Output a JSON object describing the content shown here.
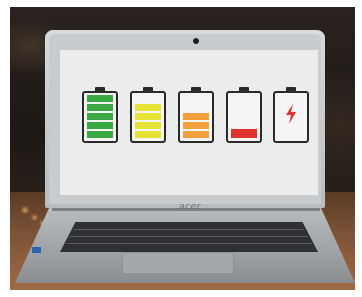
{
  "brand": {
    "logo_text": "acer"
  },
  "screen": {
    "batteries": [
      {
        "label": "full",
        "level": 1.0,
        "segments": 5,
        "color": "#3aa845"
      },
      {
        "label": "high",
        "level": 0.8,
        "segments": 4,
        "color": "#e6e234"
      },
      {
        "label": "medium",
        "level": 0.5,
        "segments": 3,
        "color": "#f2a03d"
      },
      {
        "label": "low",
        "level": 0.25,
        "segments": 1,
        "color": "#e03131"
      },
      {
        "label": "empty-charging",
        "level": 0.0,
        "segments": 0,
        "color": "#e03131",
        "icon": "lightning-bolt-icon"
      }
    ]
  },
  "colors": {
    "screen_background": "#ececec",
    "laptop_silver": "#c9ccce",
    "battery_outline": "#2a2a2a"
  }
}
